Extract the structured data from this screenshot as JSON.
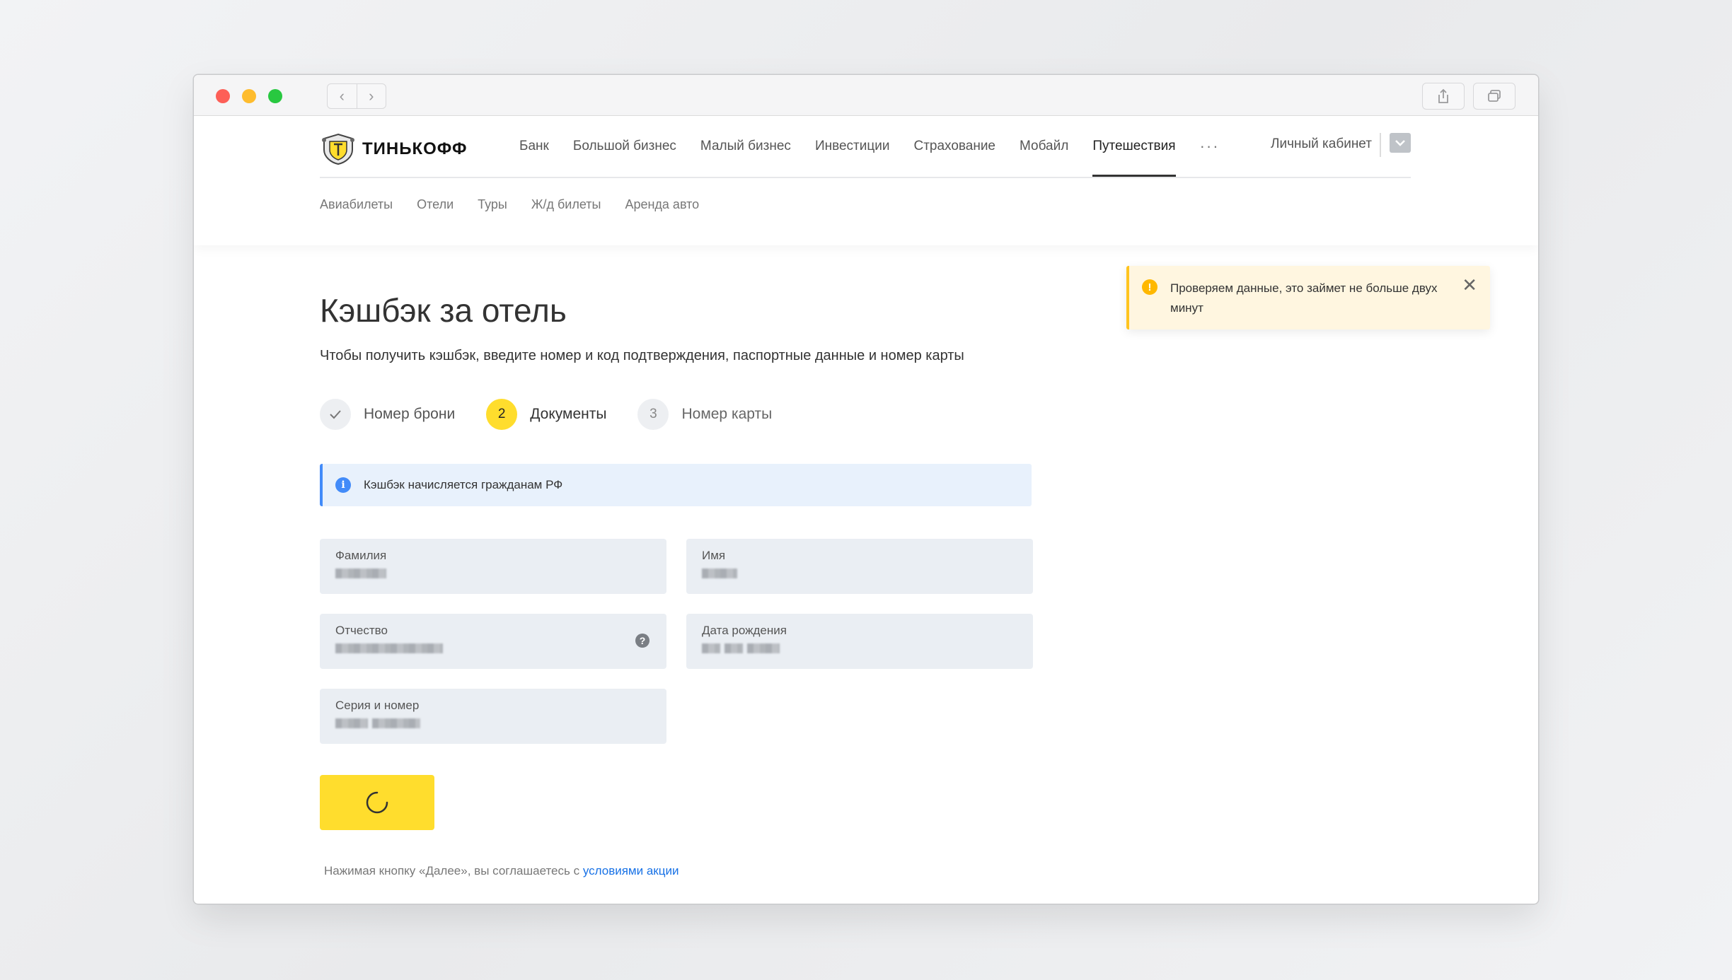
{
  "browser": {
    "nav_back": "‹",
    "nav_forward": "›"
  },
  "header": {
    "logo_text": "ТИНЬКОФФ",
    "nav": [
      "Банк",
      "Большой бизнес",
      "Малый бизнес",
      "Инвестиции",
      "Страхование",
      "Мобайл",
      "Путешествия"
    ],
    "active_nav": "Путешествия",
    "more": "···",
    "cabinet": "Личный кабинет",
    "subnav": [
      "Авиабилеты",
      "Отели",
      "Туры",
      "Ж/д билеты",
      "Аренда авто"
    ]
  },
  "page": {
    "title": "Кэшбэк за отель",
    "subtitle": "Чтобы получить кэшбэк, введите номер и код подтверждения, паспортные данные и номер карты"
  },
  "steps": [
    {
      "num": "✓",
      "label": "Номер брони",
      "state": "done"
    },
    {
      "num": "2",
      "label": "Документы",
      "state": "active"
    },
    {
      "num": "3",
      "label": "Номер карты",
      "state": "todo"
    }
  ],
  "info": {
    "icon": "i",
    "text": "Кэшбэк начисляется гражданам РФ"
  },
  "form": {
    "surname_label": "Фамилия",
    "name_label": "Имя",
    "patronymic_label": "Отчество",
    "patronymic_help": "?",
    "birthdate_label": "Дата рождения",
    "passport_label": "Серия и номер"
  },
  "footer": {
    "agree_text": "Нажимая кнопку «Далее», вы соглашаетесь с",
    "agree_link": "условиями акции"
  },
  "toast": {
    "icon": "!",
    "text": "Проверяем данные, это займет не больше двух минут",
    "close": "✕"
  },
  "colors": {
    "accent_yellow": "#ffdd2d",
    "info_blue": "#428bf9",
    "link_blue": "#1771e6",
    "warning": "#ffb800"
  }
}
